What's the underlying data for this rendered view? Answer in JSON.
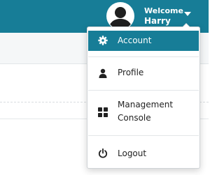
{
  "user_menu": {
    "welcome_label": "Welcome",
    "username": "Harry",
    "avatar_icon": "user-avatar-icon",
    "caret_icon": "caret-down-icon"
  },
  "dropdown": {
    "items": [
      {
        "label": "Account",
        "icon": "gear-icon",
        "active": true
      },
      {
        "label": "Profile",
        "icon": "person-icon"
      },
      {
        "label": "Management\nConsole",
        "icon": "grid-icon"
      },
      {
        "label": "Logout",
        "icon": "power-icon"
      }
    ]
  },
  "colors": {
    "brand": "#177d97",
    "text": "#222222",
    "menu_border": "#cfd3d6"
  }
}
